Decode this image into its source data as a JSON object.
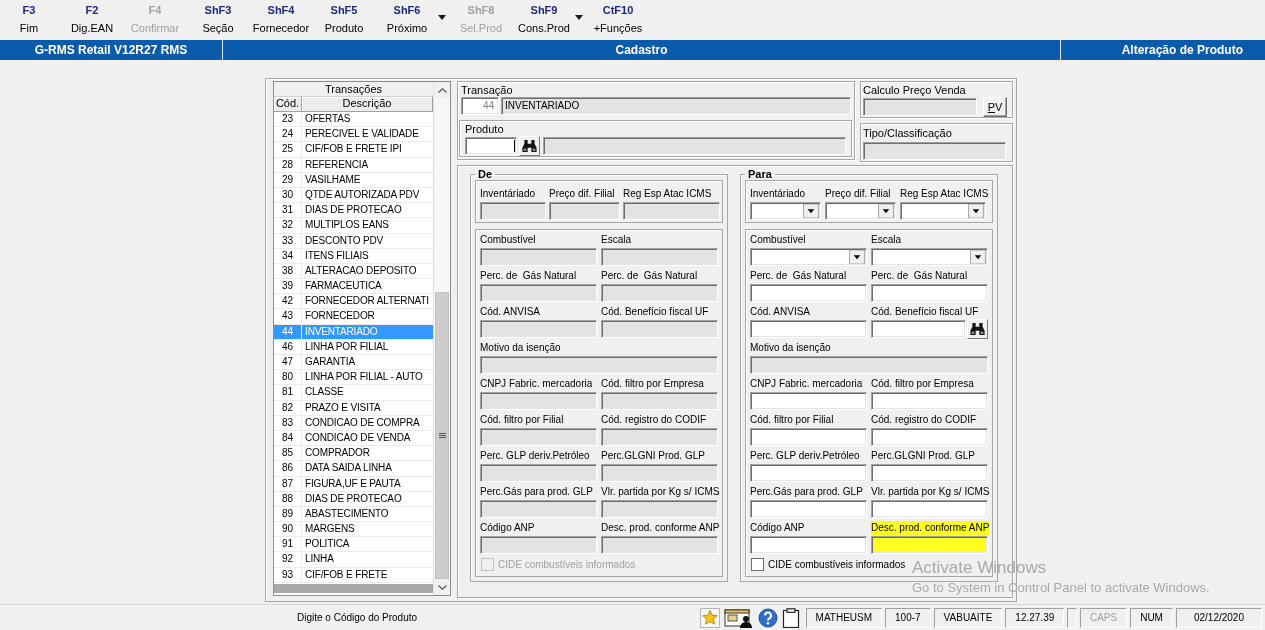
{
  "toolbar": {
    "buttons": [
      {
        "key": "F3",
        "label": "Fim",
        "disabled": false,
        "dropdown": false
      },
      {
        "key": "F2",
        "label": "Dig.EAN",
        "disabled": false,
        "dropdown": false
      },
      {
        "key": "F4",
        "label": "Confirmar",
        "disabled": true,
        "dropdown": false
      },
      {
        "key": "ShF3",
        "label": "Seção",
        "disabled": false,
        "dropdown": false
      },
      {
        "key": "ShF4",
        "label": "Fornecedor",
        "disabled": false,
        "dropdown": false
      },
      {
        "key": "ShF5",
        "label": "Produto",
        "disabled": false,
        "dropdown": false
      },
      {
        "key": "ShF6",
        "label": "Próximo",
        "disabled": false,
        "dropdown": true
      },
      {
        "key": "ShF8",
        "label": "Sel.Prod",
        "disabled": true,
        "dropdown": false
      },
      {
        "key": "ShF9",
        "label": "Cons.Prod",
        "disabled": false,
        "dropdown": true
      },
      {
        "key": "CtF10",
        "label": "+Funções",
        "disabled": false,
        "dropdown": false
      }
    ]
  },
  "title_bar": {
    "app": "G-RMS Retail V12R27 RMS",
    "module": "Cadastro",
    "screen": "Alteração de Produto"
  },
  "transactions": {
    "title": "Transações",
    "columns": [
      "Cód.",
      "Descrição"
    ],
    "rows": [
      {
        "code": "23",
        "description": "OFERTAS",
        "selected": false
      },
      {
        "code": "24",
        "description": "PERECIVEL E VALIDADE",
        "selected": false
      },
      {
        "code": "25",
        "description": "CIF/FOB E FRETE IPI",
        "selected": false
      },
      {
        "code": "28",
        "description": "REFERENCIA",
        "selected": false
      },
      {
        "code": "29",
        "description": "VASILHAME",
        "selected": false
      },
      {
        "code": "30",
        "description": "QTDE AUTORIZADA PDV",
        "selected": false
      },
      {
        "code": "31",
        "description": "DIAS DE PROTECAO",
        "selected": false
      },
      {
        "code": "32",
        "description": "MULTIPLOS EANS",
        "selected": false
      },
      {
        "code": "33",
        "description": "DESCONTO PDV",
        "selected": false
      },
      {
        "code": "34",
        "description": "ITENS FILIAIS",
        "selected": false
      },
      {
        "code": "38",
        "description": "ALTERACAO DEPOSITO",
        "selected": false
      },
      {
        "code": "39",
        "description": "FARMACEUTICA",
        "selected": false
      },
      {
        "code": "42",
        "description": "FORNECEDOR ALTERNATI",
        "selected": false
      },
      {
        "code": "43",
        "description": "FORNECEDOR",
        "selected": false
      },
      {
        "code": "44",
        "description": "INVENTARIADO",
        "selected": true
      },
      {
        "code": "46",
        "description": "LINHA POR FILIAL",
        "selected": false
      },
      {
        "code": "47",
        "description": "GARANTIA",
        "selected": false
      },
      {
        "code": "80",
        "description": "LINHA POR FILIAL - AUTO",
        "selected": false
      },
      {
        "code": "81",
        "description": "CLASSE",
        "selected": false
      },
      {
        "code": "82",
        "description": "PRAZO E VISITA",
        "selected": false
      },
      {
        "code": "83",
        "description": "CONDICAO DE COMPRA",
        "selected": false
      },
      {
        "code": "84",
        "description": "CONDICAO DE VENDA",
        "selected": false
      },
      {
        "code": "85",
        "description": "COMPRADOR",
        "selected": false
      },
      {
        "code": "86",
        "description": "DATA SAIDA LINHA",
        "selected": false
      },
      {
        "code": "87",
        "description": "FIGURA,UF E PAUTA",
        "selected": false
      },
      {
        "code": "88",
        "description": "DIAS DE PROTECAO",
        "selected": false
      },
      {
        "code": "89",
        "description": "ABASTECIMENTO",
        "selected": false
      },
      {
        "code": "90",
        "description": "MARGENS",
        "selected": false
      },
      {
        "code": "91",
        "description": "POLITICA",
        "selected": false
      },
      {
        "code": "92",
        "description": "LINHA",
        "selected": false
      },
      {
        "code": "93",
        "description": "CIF/FOB E FRETE",
        "selected": false
      }
    ]
  },
  "transacao": {
    "label": "Transação",
    "code": "44",
    "description": "INVENTARIADO"
  },
  "produto": {
    "label": "Produto"
  },
  "calculo_preco_venda": {
    "label": "Calculo Preço Venda",
    "button": "PV"
  },
  "tipo_classificacao": {
    "label": "Tipo/Classificação"
  },
  "de": {
    "title": "De",
    "top_fields": [
      {
        "label": "Inventáriado",
        "kind": "text",
        "disabled": true
      },
      {
        "label": "Preço dif. Filial",
        "kind": "text",
        "disabled": true
      },
      {
        "label": "Reg Esp Atac ICMS",
        "kind": "text",
        "disabled": true
      }
    ],
    "rows": [
      [
        {
          "label": "Combustível",
          "kind": "text",
          "disabled": true
        },
        {
          "label": "Escala",
          "kind": "text",
          "disabled": true
        }
      ],
      [
        {
          "label": "Perc. de  Gás Natural",
          "kind": "text",
          "disabled": true
        },
        {
          "label": "Perc. de  Gás Natural",
          "kind": "text",
          "disabled": true
        }
      ],
      [
        {
          "label": "Cód. ANVISA",
          "kind": "text",
          "disabled": true
        },
        {
          "label": "Cód. Benefício fiscal UF",
          "kind": "text",
          "disabled": true
        }
      ],
      [
        {
          "label": "Motivo da isenção",
          "kind": "text",
          "disabled": true
        }
      ],
      [
        {
          "label": "CNPJ Fabric. mercadoria",
          "kind": "text",
          "disabled": true
        },
        {
          "label": "Cód. filtro por Empresa",
          "kind": "text",
          "disabled": true
        }
      ],
      [
        {
          "label": "Cód. filtro por Filial",
          "kind": "text",
          "disabled": true
        },
        {
          "label": "Cód. registro do CODIF",
          "kind": "text",
          "disabled": true
        }
      ],
      [
        {
          "label": "Perc. GLP deriv.Petróleo",
          "kind": "text",
          "disabled": true
        },
        {
          "label": "Perc.GLGNI Prod. GLP",
          "kind": "text",
          "disabled": true
        }
      ],
      [
        {
          "label": "Perc.Gás para prod. GLP",
          "kind": "text",
          "disabled": true
        },
        {
          "label": "Vlr. partida por Kg s/ ICMS",
          "kind": "text",
          "disabled": true
        }
      ],
      [
        {
          "label": "Código ANP",
          "kind": "text",
          "disabled": true
        },
        {
          "label": "Desc. prod. conforme ANP",
          "kind": "text",
          "disabled": true
        }
      ]
    ],
    "checkbox": {
      "label": "CIDE combustíveis informados",
      "checked": false,
      "disabled": true
    }
  },
  "para": {
    "title": "Para",
    "top_fields": [
      {
        "label": "Inventáriado",
        "kind": "dropdown",
        "disabled": false
      },
      {
        "label": "Preço dif. Filial",
        "kind": "dropdown",
        "disabled": false
      },
      {
        "label": "Reg Esp Atac ICMS",
        "kind": "dropdown",
        "disabled": false
      }
    ],
    "rows": [
      [
        {
          "label": "Combustível",
          "kind": "dropdown",
          "disabled": false,
          "highlighted": false
        },
        {
          "label": "Escala",
          "kind": "dropdown",
          "disabled": false,
          "highlighted": false
        }
      ],
      [
        {
          "label": "Perc. de  Gás Natural",
          "kind": "text",
          "disabled": false,
          "highlighted": false
        },
        {
          "label": "Perc. de  Gás Natural",
          "kind": "text",
          "disabled": false,
          "highlighted": false
        }
      ],
      [
        {
          "label": "Cód. ANVISA",
          "kind": "text",
          "disabled": false,
          "highlighted": false
        },
        {
          "label": "Cód. Benefício fiscal UF",
          "kind": "lookup",
          "disabled": false,
          "highlighted": false
        }
      ],
      [
        {
          "label": "Motivo da isenção",
          "kind": "text",
          "disabled": true,
          "highlighted": false
        }
      ],
      [
        {
          "label": "CNPJ Fabric. mercadoria",
          "kind": "text",
          "disabled": false,
          "highlighted": false
        },
        {
          "label": "Cód. filtro por Empresa",
          "kind": "text",
          "disabled": false,
          "highlighted": false
        }
      ],
      [
        {
          "label": "Cód. filtro por Filial",
          "kind": "text",
          "disabled": false,
          "highlighted": false
        },
        {
          "label": "Cód. registro do CODIF",
          "kind": "text",
          "disabled": false,
          "highlighted": false
        }
      ],
      [
        {
          "label": "Perc. GLP deriv.Petróleo",
          "kind": "text",
          "disabled": false,
          "highlighted": false
        },
        {
          "label": "Perc.GLGNI Prod. GLP",
          "kind": "text",
          "disabled": false,
          "highlighted": false
        }
      ],
      [
        {
          "label": "Perc.Gás para prod. GLP",
          "kind": "text",
          "disabled": false,
          "highlighted": false
        },
        {
          "label": "Vlr. partida por Kg s/ ICMS",
          "kind": "text",
          "disabled": false,
          "highlighted": false
        }
      ],
      [
        {
          "label": "Código ANP",
          "kind": "text",
          "disabled": false,
          "highlighted": false
        },
        {
          "label": "Desc. prod. conforme ANP",
          "kind": "text",
          "disabled": false,
          "highlighted": true
        }
      ]
    ],
    "checkbox": {
      "label": "CIDE combustíveis informados",
      "checked": false,
      "disabled": false
    }
  },
  "status_bar": {
    "message": "Digite o Código do Produto",
    "panels": [
      {
        "text": "MATHEUSM"
      },
      {
        "text": "100-7"
      },
      {
        "text": "VABUAITE"
      },
      {
        "text": "12.27.39"
      }
    ],
    "indicators": [
      {
        "label": "CAPS",
        "on": false
      },
      {
        "label": "NUM",
        "on": true
      }
    ],
    "date": "02/12/2020"
  },
  "activation_notice": {
    "title": "Activate Windows",
    "text": "Go to System in Control Panel to activate Windows."
  }
}
